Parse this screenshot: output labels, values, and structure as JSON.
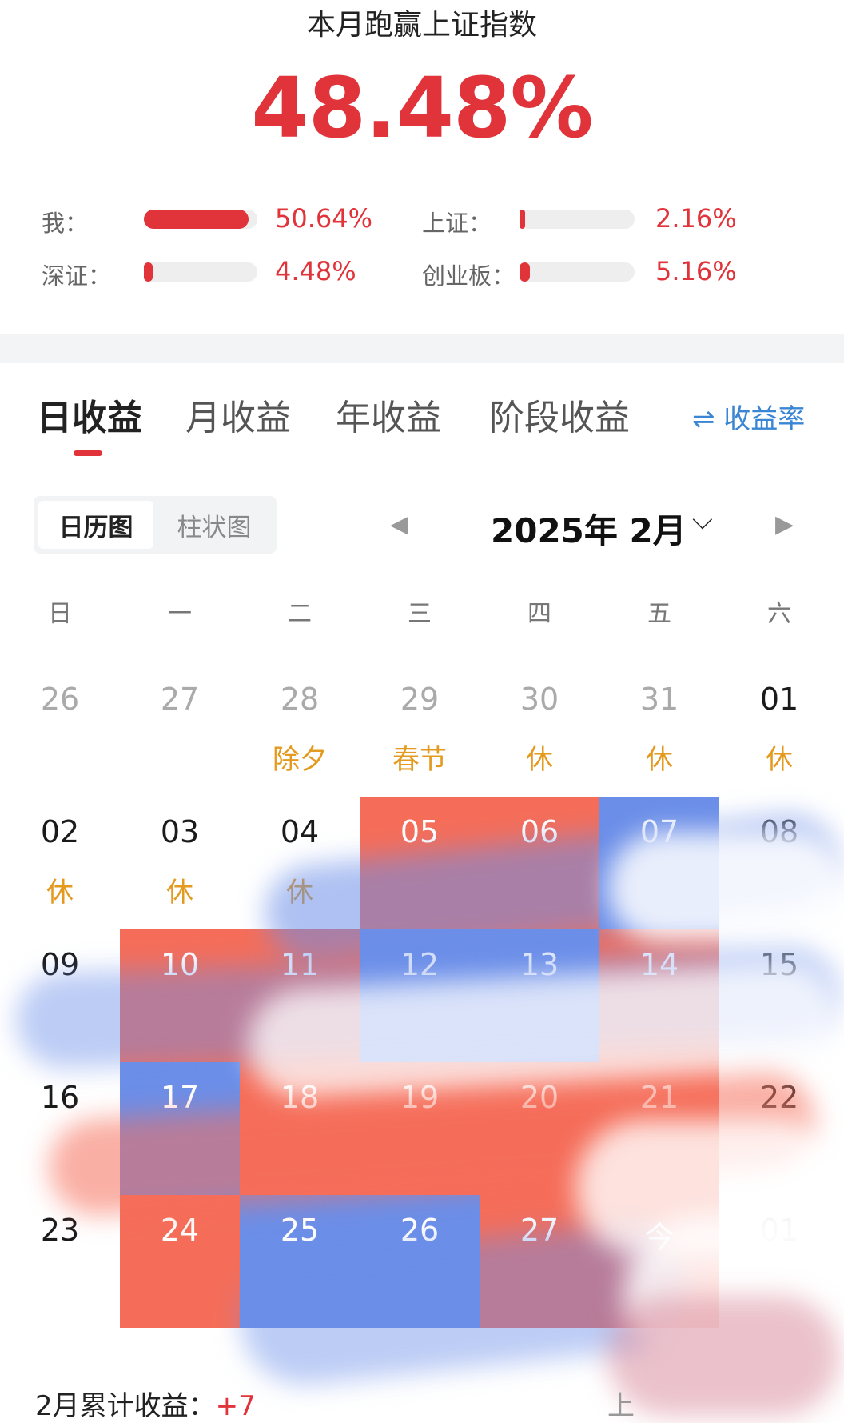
{
  "header": {
    "title": "本月跑赢上证指数",
    "outperform_pct": "48.48%"
  },
  "comparisons": [
    {
      "label": "我：",
      "value": "50.64%",
      "fill": 0.92
    },
    {
      "label": "上证：",
      "value": "2.16%",
      "fill": 0.04
    },
    {
      "label": "深证：",
      "value": "4.48%",
      "fill": 0.08
    },
    {
      "label": "创业板：",
      "value": "5.16%",
      "fill": 0.09
    }
  ],
  "tabs": [
    "日收益",
    "月收益",
    "年收益",
    "阶段收益"
  ],
  "active_tab": 0,
  "rate_toggle": "⇌ 收益率",
  "view_toggle": {
    "calendar": "日历图",
    "bar": "柱状图"
  },
  "month_nav": {
    "prev": "◀",
    "title": "2025年 2月",
    "chevron": "⌵",
    "next": "▶"
  },
  "weekdays": [
    "日",
    "一",
    "二",
    "三",
    "四",
    "五",
    "六"
  ],
  "calendar": {
    "rows": [
      [
        {
          "d": "26",
          "s": "gray"
        },
        {
          "d": "27",
          "s": "gray"
        },
        {
          "d": "28",
          "s": "gray",
          "t": "除夕"
        },
        {
          "d": "29",
          "s": "gray",
          "t": "春节"
        },
        {
          "d": "30",
          "s": "gray",
          "t": "休"
        },
        {
          "d": "31",
          "s": "gray",
          "t": "休"
        },
        {
          "d": "01",
          "s": "dark",
          "t": "休"
        }
      ],
      [
        {
          "d": "02",
          "s": "dark",
          "t": "休"
        },
        {
          "d": "03",
          "s": "dark",
          "t": "休"
        },
        {
          "d": "04",
          "s": "dark",
          "t": "休"
        },
        {
          "d": "05",
          "s": "red"
        },
        {
          "d": "06",
          "s": "red"
        },
        {
          "d": "07",
          "s": "blue"
        },
        {
          "d": "08",
          "s": "dark"
        }
      ],
      [
        {
          "d": "09",
          "s": "dark"
        },
        {
          "d": "10",
          "s": "red"
        },
        {
          "d": "11",
          "s": "red"
        },
        {
          "d": "12",
          "s": "blue"
        },
        {
          "d": "13",
          "s": "blue"
        },
        {
          "d": "14",
          "s": "red"
        },
        {
          "d": "15",
          "s": "dark"
        }
      ],
      [
        {
          "d": "16",
          "s": "dark"
        },
        {
          "d": "17",
          "s": "blue"
        },
        {
          "d": "18",
          "s": "red"
        },
        {
          "d": "19",
          "s": "red"
        },
        {
          "d": "20",
          "s": "red"
        },
        {
          "d": "21",
          "s": "red"
        },
        {
          "d": "22",
          "s": "dark"
        }
      ],
      [
        {
          "d": "23",
          "s": "dark"
        },
        {
          "d": "24",
          "s": "red"
        },
        {
          "d": "25",
          "s": "blue"
        },
        {
          "d": "26",
          "s": "blue"
        },
        {
          "d": "27",
          "s": "red"
        },
        {
          "d": "今",
          "s": "red"
        },
        {
          "d": "01",
          "s": "gray"
        }
      ]
    ]
  },
  "summary": {
    "label": "2月累计收益：",
    "value": "+7",
    "right": "上"
  },
  "colors": {
    "red": "#e0333a",
    "gain": "#f56d59",
    "loss": "#6b8ee8",
    "holiday": "#e39a1f",
    "link": "#3a86d4"
  }
}
